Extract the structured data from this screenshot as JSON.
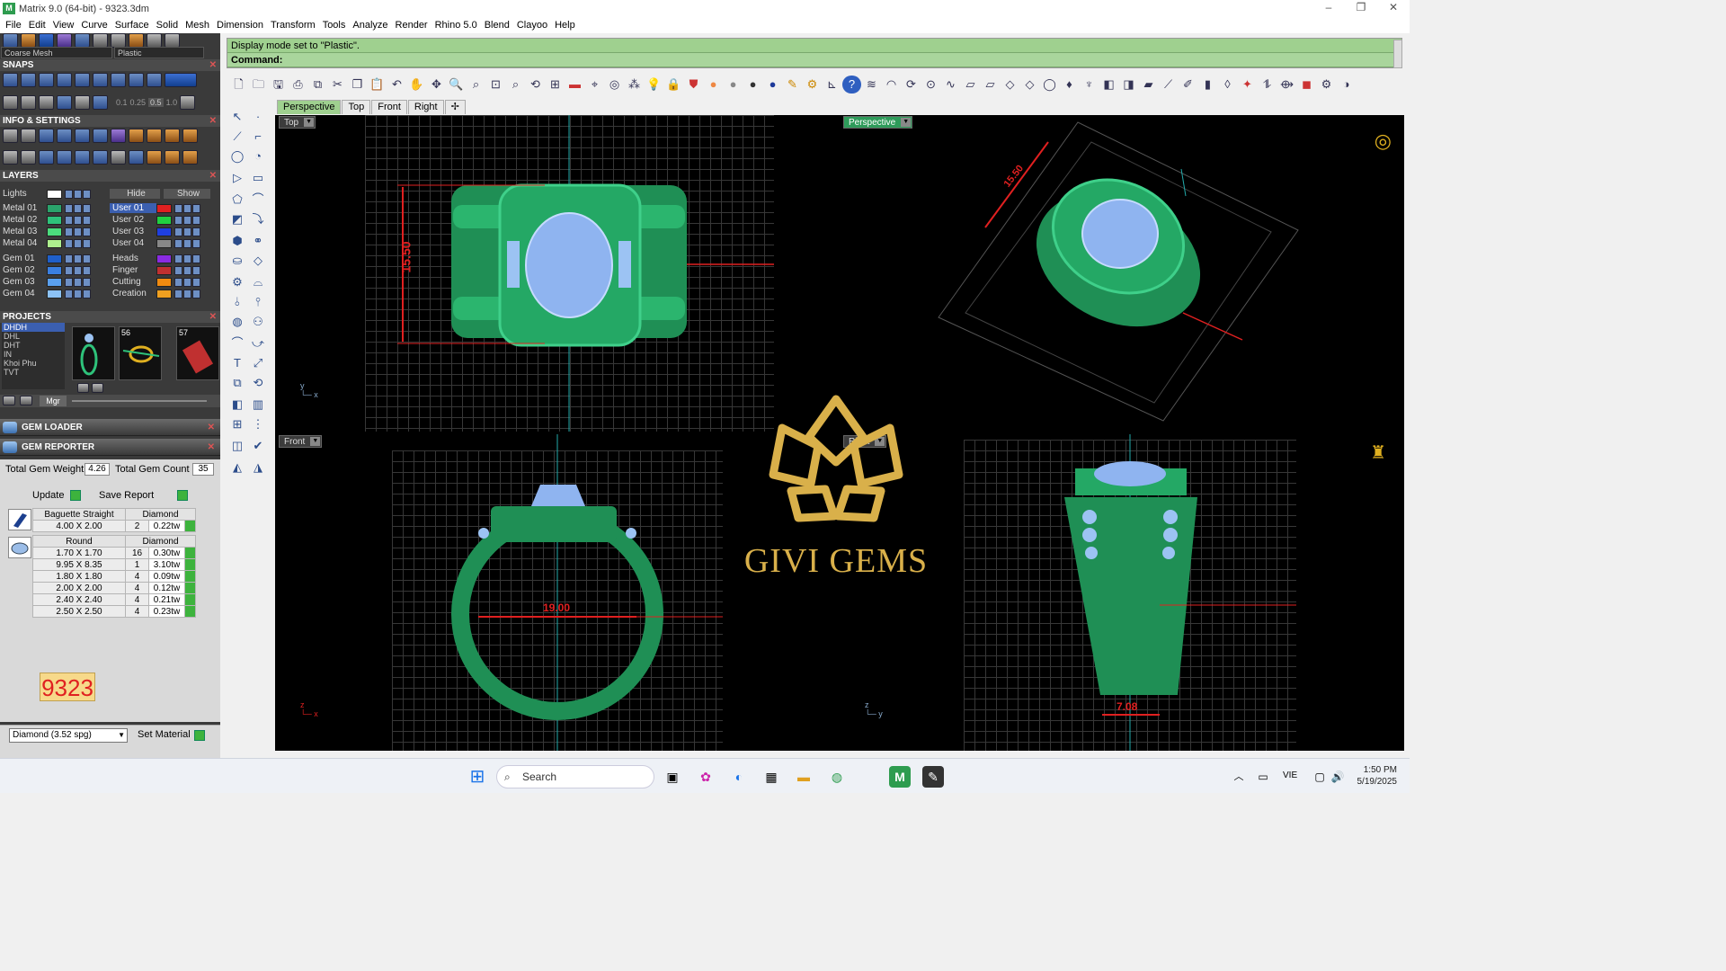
{
  "window": {
    "title": "Matrix 9.0 (64-bit) - 9323.3dm",
    "min": "–",
    "max": "❐",
    "close": "✕"
  },
  "menu": [
    "File",
    "Edit",
    "View",
    "Curve",
    "Surface",
    "Solid",
    "Mesh",
    "Dimension",
    "Transform",
    "Tools",
    "Analyze",
    "Render",
    "Rhino 5.0",
    "Blend",
    "Clayoo",
    "Help"
  ],
  "left": {
    "mesh_dropdown": "Coarse Mesh",
    "material_dropdown": "Plastic",
    "sections": {
      "snaps": "SNAPS",
      "info": "INFO & SETTINGS",
      "layers": "LAYERS",
      "projects": "PROJECTS"
    },
    "snap_values": [
      "0.1",
      "0.25",
      "0.5",
      "1.0"
    ],
    "layers_left": [
      {
        "name": "Lights",
        "color": "#ffffff"
      },
      {
        "name": "Metal 01",
        "color": "#2aa36b"
      },
      {
        "name": "Metal 02",
        "color": "#2ec27a"
      },
      {
        "name": "Metal 03",
        "color": "#4bdc7d"
      },
      {
        "name": "Metal 04",
        "color": "#aef08e"
      },
      {
        "name": "Gem 01",
        "color": "#1f5fc9"
      },
      {
        "name": "Gem 02",
        "color": "#3a7fe0"
      },
      {
        "name": "Gem 03",
        "color": "#5aa0ee"
      },
      {
        "name": "Gem 04",
        "color": "#8cc2f5"
      }
    ],
    "layers_right": [
      {
        "name": "Hide",
        "color": ""
      },
      {
        "name": "User 01",
        "color": "#e02020"
      },
      {
        "name": "User 02",
        "color": "#20d040"
      },
      {
        "name": "User 03",
        "color": "#1f3fe0"
      },
      {
        "name": "User 04",
        "color": "#888888"
      },
      {
        "name": "Heads",
        "color": "#8a2be2"
      },
      {
        "name": "Finger",
        "color": "#c03030"
      },
      {
        "name": "Cutting",
        "color": "#f08a10"
      },
      {
        "name": "Creation",
        "color": "#f0a020"
      }
    ],
    "show_label": "Show",
    "projects": [
      "DHDH",
      "DHL",
      "DHT",
      "IN",
      "Khoi Phu",
      "TVT"
    ],
    "thumbs": [
      "",
      "56",
      "57"
    ],
    "mgr_label": "Mgr"
  },
  "gem_loader": "GEM LOADER",
  "gem_reporter": {
    "title": "GEM REPORTER",
    "total_weight_label": "Total Gem Weight",
    "total_weight": "4.26",
    "total_count_label": "Total Gem Count",
    "total_count": "35",
    "update_label": "Update",
    "save_label": "Save Report",
    "groups": [
      {
        "shape": "Baguette Straight",
        "material": "Diamond",
        "rows": [
          {
            "size": "4.00 X 2.00",
            "count": "2",
            "weight": "0.22tw"
          }
        ]
      },
      {
        "shape": "Round",
        "material": "Diamond",
        "rows": [
          {
            "size": "1.70 X 1.70",
            "count": "16",
            "weight": "0.30tw"
          },
          {
            "size": "9.95 X 8.35",
            "count": "1",
            "weight": "3.10tw"
          },
          {
            "size": "1.80 X 1.80",
            "count": "4",
            "weight": "0.09tw"
          },
          {
            "size": "2.00 X 2.00",
            "count": "4",
            "weight": "0.12tw"
          },
          {
            "size": "2.40 X 2.40",
            "count": "4",
            "weight": "0.21tw"
          },
          {
            "size": "2.50 X 2.50",
            "count": "4",
            "weight": "0.23tw"
          }
        ]
      }
    ],
    "report_number": "9323",
    "material_select": "Diamond     (3.52 spg)",
    "set_material_label": "Set Material"
  },
  "command": {
    "history": "Display mode set to \"Plastic\".",
    "prompt": "Command:"
  },
  "viewport_tabs": [
    "Perspective",
    "Top",
    "Front",
    "Right",
    "✢"
  ],
  "viewports": {
    "top": {
      "label": "Top",
      "dim": "15.50"
    },
    "perspective": {
      "label": "Perspective",
      "dim": "15.50"
    },
    "front": {
      "label": "Front",
      "dim": "19.00"
    },
    "right": {
      "label": "Right",
      "dim": "7.08"
    }
  },
  "watermark": "GIVI GEMS",
  "taskbar": {
    "search": "Search",
    "lang": "VIE",
    "time": "1:50 PM",
    "date": "5/19/2025"
  },
  "colors": {
    "metal": "#1f8f55",
    "gem": "#8fb4f0",
    "dimension": "#e02020",
    "command_bg": "#9fd08f"
  }
}
